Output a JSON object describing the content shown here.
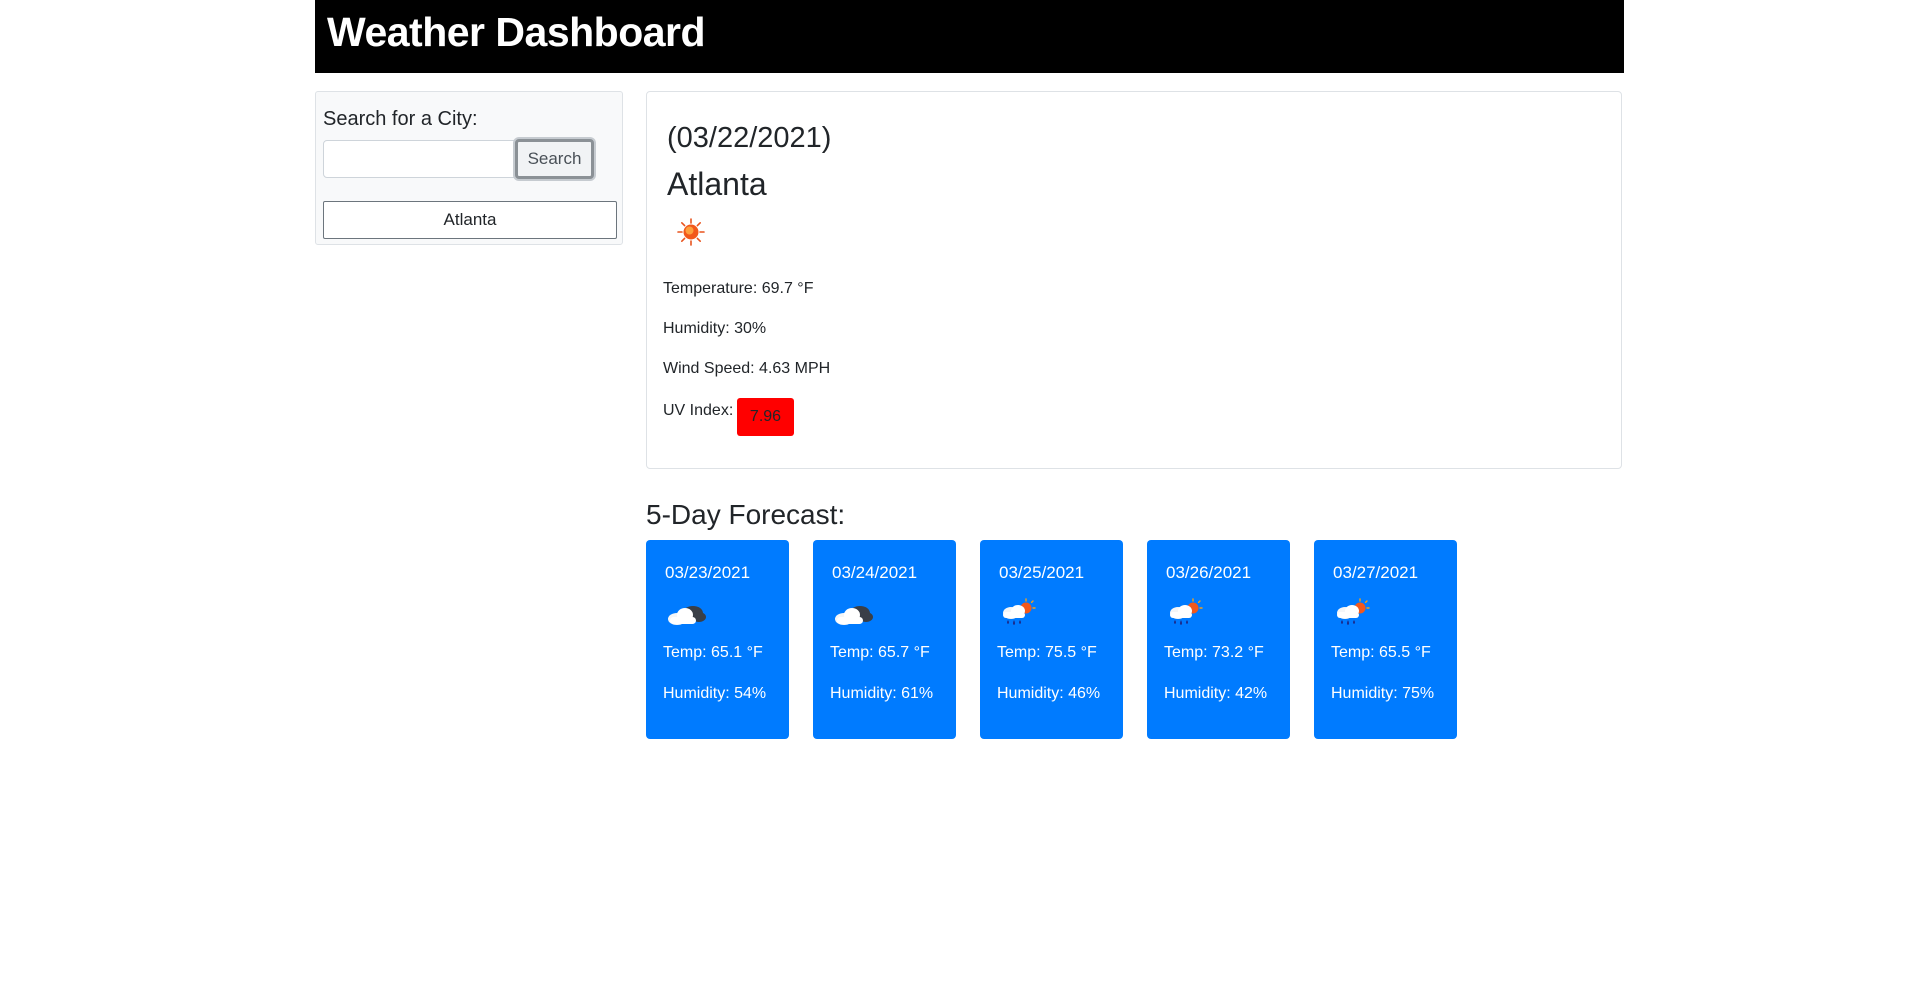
{
  "header": {
    "title": "Weather Dashboard"
  },
  "search": {
    "label": "Search for a City:",
    "input_value": "",
    "placeholder": "",
    "button_label": "Search",
    "history": [
      "Atlanta"
    ]
  },
  "current": {
    "date": "(03/22/2021)",
    "city": "Atlanta",
    "icon": "sun-icon",
    "temperature": "Temperature: 69.7 °F",
    "humidity": "Humidity: 30%",
    "wind": "Wind Speed: 4.63 MPH",
    "uv_label": "UV Index:",
    "uv_value": "7.96",
    "uv_color": "#ff0000"
  },
  "forecast": {
    "title": "5-Day Forecast:",
    "card_color": "#007bff",
    "days": [
      {
        "date": "03/23/2021",
        "icon": "cloudy-icon",
        "temp": "Temp: 65.1 °F",
        "humidity": "Humidity: 54%"
      },
      {
        "date": "03/24/2021",
        "icon": "cloudy-icon",
        "temp": "Temp: 65.7 °F",
        "humidity": "Humidity: 61%"
      },
      {
        "date": "03/25/2021",
        "icon": "rain-sun-icon",
        "temp": "Temp: 75.5 °F",
        "humidity": "Humidity: 46%"
      },
      {
        "date": "03/26/2021",
        "icon": "rain-sun-icon",
        "temp": "Temp: 73.2 °F",
        "humidity": "Humidity: 42%"
      },
      {
        "date": "03/27/2021",
        "icon": "rain-sun-icon",
        "temp": "Temp: 65.5 °F",
        "humidity": "Humidity: 75%"
      }
    ]
  }
}
